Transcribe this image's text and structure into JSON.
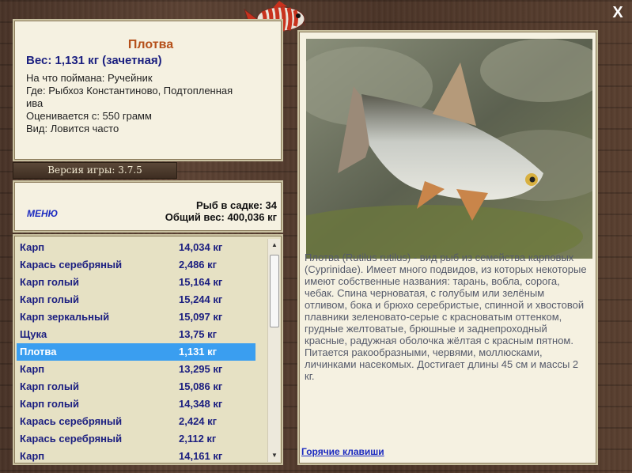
{
  "header": {
    "close_label": "X"
  },
  "catch": {
    "name": "Плотва",
    "weight": "Вес: 1,131 кг (зачетная)",
    "lines": [
      "На что поймана: Ручейник",
      "Где: Рыбхоз Константиново, Подтопленная",
      "ива",
      "Оценивается с: 550 грамм",
      "Вид: Ловится часто"
    ]
  },
  "version": "Версия игры: 3.7.5",
  "menu": {
    "label": "МЕНЮ"
  },
  "stats": {
    "count": "Рыб в садке: 34",
    "total": "Общий вес: 400,036 кг"
  },
  "fish_list": [
    {
      "name": "Карп",
      "weight": "14,034 кг"
    },
    {
      "name": "Карась серебряный",
      "weight": "2,486 кг"
    },
    {
      "name": "Карп голый",
      "weight": "15,164 кг"
    },
    {
      "name": "Карп голый",
      "weight": "15,244 кг"
    },
    {
      "name": "Карп зеркальный",
      "weight": "15,097 кг"
    },
    {
      "name": "Щука",
      "weight": "13,75 кг"
    },
    {
      "name": "Плотва",
      "weight": "1,131 кг"
    },
    {
      "name": "Карп",
      "weight": "13,295 кг"
    },
    {
      "name": "Карп голый",
      "weight": "15,086 кг"
    },
    {
      "name": "Карп голый",
      "weight": "14,348 кг"
    },
    {
      "name": "Карась серебряный",
      "weight": "2,424 кг"
    },
    {
      "name": "Карась серебряный",
      "weight": "2,112 кг"
    },
    {
      "name": "Карп",
      "weight": "14,161 кг"
    }
  ],
  "selected_index": 6,
  "description": "Плотва (Rutilus rutilus) - вид рыб из семейства карповых (Cyprinidae). Имеет много подвидов, из которых некоторые имеют собственные названия: тарань, вобла, сорога, чебак. Спина черноватая, с голубым или зелёным отливом, бока и брюхо серебристые, спинной и хвостовой плавники зеленовато-серые с красноватым оттенком, грудные желтоватые, брюшные и заднепроходный красные, радужная оболочка жёлтая с красным пятном. Питается ракообразными, червями, моллюсками, личинками насекомых. Достигает длины 45 см и массы 2 кг.",
  "hotkeys": {
    "label": "Горячие клавиши"
  },
  "colors": {
    "selection": "#3a9ef0",
    "link": "#1b2ac0",
    "fish_name": "#b5501a",
    "list_text": "#1b1e80"
  }
}
